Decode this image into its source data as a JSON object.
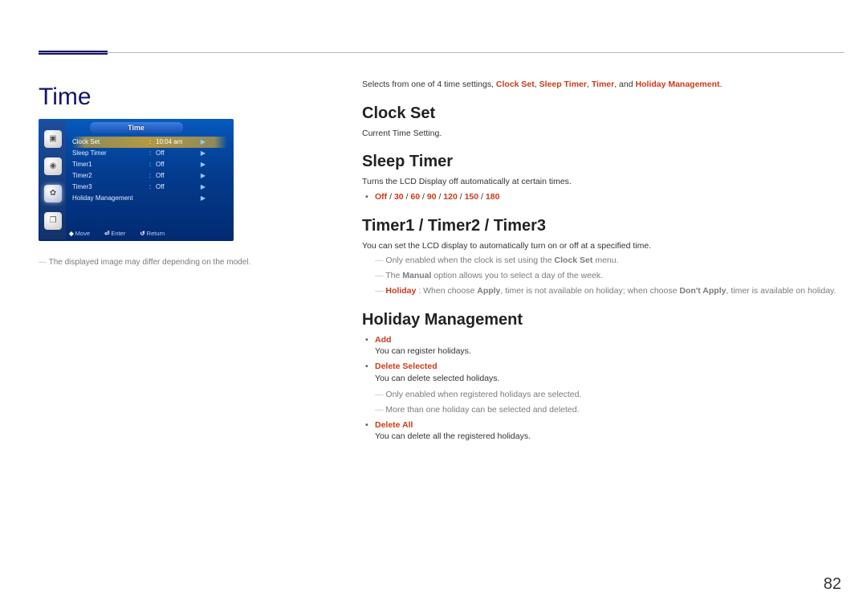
{
  "page": {
    "title": "Time",
    "number": "82",
    "image_note": "The displayed image may differ depending on the model."
  },
  "osd": {
    "tab_title": "Time",
    "rows": [
      {
        "label": "Clock Set",
        "value": "10:04 am",
        "selected": true
      },
      {
        "label": "Sleep Timer",
        "value": "Off",
        "selected": false
      },
      {
        "label": "Timer1",
        "value": "Off",
        "selected": false
      },
      {
        "label": "Timer2",
        "value": "Off",
        "selected": false
      },
      {
        "label": "Timer3",
        "value": "Off",
        "selected": false
      },
      {
        "label": "Holiday Management",
        "value": "",
        "selected": false
      }
    ],
    "footer": {
      "move": "Move",
      "enter": "Enter",
      "ret": "Return"
    }
  },
  "intro": {
    "pre": "Selects from one of 4 time settings, ",
    "item1": "Clock Set",
    "item2": "Sleep Timer",
    "item3": "Timer",
    "and": ", and ",
    "item4": "Holiday Management",
    "end": "."
  },
  "clock_set": {
    "heading": "Clock Set",
    "body": "Current Time Setting."
  },
  "sleep_timer": {
    "heading": "Sleep Timer",
    "body": "Turns the LCD Display off automatically at certain times.",
    "options": [
      "Off",
      "30",
      "60",
      "90",
      "120",
      "150",
      "180"
    ]
  },
  "timers": {
    "heading": "Timer1 / Timer2 / Timer3",
    "body": "You can set the LCD display to automatically turn on or off at a specified time.",
    "note1_pre": "Only enabled when the clock is set using the ",
    "note1_bold": "Clock Set",
    "note1_post": " menu.",
    "note2_pre": "The ",
    "note2_bold": "Manual",
    "note2_post": " option allows you to select a day of the week.",
    "note3_label": "Holiday",
    "note3_pre": " : When choose ",
    "note3_apply": "Apply",
    "note3_mid": ", timer is not available on holiday; when choose ",
    "note3_dont": "Don't Apply",
    "note3_post": ", timer is available on holiday."
  },
  "holiday": {
    "heading": "Holiday Management",
    "add_label": "Add",
    "add_body": "You can register holidays.",
    "del_sel_label": "Delete Selected",
    "del_sel_body": "You can delete selected holidays.",
    "del_sel_note1": "Only enabled when registered holidays are selected.",
    "del_sel_note2": "More than one holiday can be selected and deleted.",
    "del_all_label": "Delete All",
    "del_all_body": "You can delete all the registered holidays."
  }
}
